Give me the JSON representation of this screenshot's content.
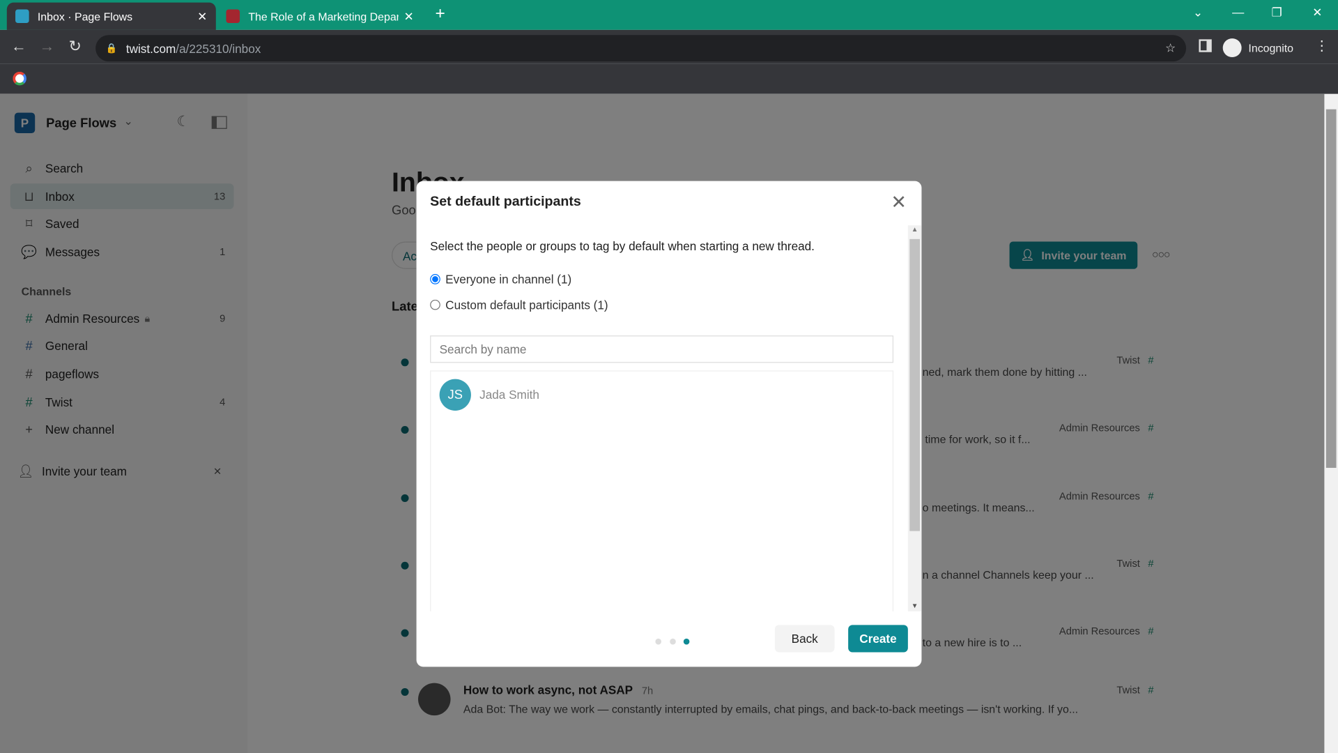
{
  "browser": {
    "tabs": [
      {
        "title": "Inbox · Page Flows",
        "active": true
      },
      {
        "title": "The Role of a Marketing Depart",
        "active": false
      }
    ],
    "url_host": "twist.com",
    "url_path": "/a/225310/inbox",
    "profile": "Incognito",
    "accent": "#0e9275"
  },
  "sidebar": {
    "workspace": "Page Flows",
    "workspace_initial": "P",
    "nav": [
      {
        "label": "Search",
        "icon": "search-icon",
        "count": ""
      },
      {
        "label": "Inbox",
        "icon": "inbox-icon",
        "count": "13"
      },
      {
        "label": "Saved",
        "icon": "bookmark-icon",
        "count": ""
      },
      {
        "label": "Messages",
        "icon": "chat-icon",
        "count": "1"
      }
    ],
    "channels_heading": "Channels",
    "channels": [
      {
        "label": "Admin Resources",
        "count": "9",
        "locked": true
      },
      {
        "label": "General",
        "count": ""
      },
      {
        "label": "pageflows",
        "count": ""
      },
      {
        "label": "Twist",
        "count": "4"
      }
    ],
    "new_channel": "New channel",
    "invite": "Invite your team"
  },
  "main": {
    "title": "Inbox",
    "subtitle": "Goo",
    "filter": "Ac",
    "section": "Late",
    "invite_button": "Invite your team",
    "rows": [
      {
        "snippet": "ned, mark them done by hitting ...",
        "channel": "Twist"
      },
      {
        "snippet": "time for work, so it f...",
        "channel": "Admin Resources"
      },
      {
        "snippet": "o meetings. It means...",
        "channel": "Admin Resources"
      },
      {
        "snippet": "n a channel Channels keep your ...",
        "channel": "Twist"
      },
      {
        "snippet": "to a new hire is to ...",
        "channel": "Admin Resources"
      },
      {
        "title": "How to work async, not ASAP",
        "time": "7h",
        "snippet": "Ada Bot: The way we work — constantly interrupted by emails, chat pings, and back-to-back meetings — isn't working. If yo...",
        "channel": "Twist"
      }
    ]
  },
  "modal": {
    "title": "Set default participants",
    "description": "Select the people or groups to tag by default when starting a new thread.",
    "options": [
      {
        "label": "Everyone in channel (1)",
        "checked": true
      },
      {
        "label": "Custom default participants (1)",
        "checked": false
      }
    ],
    "search_placeholder": "Search by name",
    "people": [
      {
        "initials": "JS",
        "name": "Jada Smith"
      }
    ],
    "step": 3,
    "steps_total": 3,
    "back": "Back",
    "create": "Create"
  }
}
